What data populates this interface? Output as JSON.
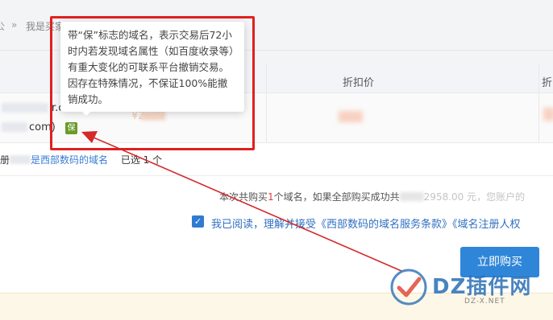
{
  "breadcrumb": {
    "home": "公",
    "separator": "»",
    "current": "我是买家"
  },
  "table": {
    "headers": {
      "discount_price": "折扣价",
      "more": "折"
    },
    "row": {
      "domain_1": "r.con",
      "domain_2": "com)",
      "protect_badge": "保",
      "price_symbol": "¥2530"
    }
  },
  "selection": {
    "prefix": "册",
    "link_text": "是西部数码的域名",
    "selected_count": "已选 1 个"
  },
  "summary": {
    "text_1": "本次共购买",
    "count": "1",
    "text_2": "个域名，如果全部购买成功共",
    "text_3": "2958.00 元，您账户的"
  },
  "agreement": {
    "checked_icon": "✓",
    "text": "我已阅读，理解并接受《西部数码的域名服务条款》《域名注册人权"
  },
  "actions": {
    "buy_now": "立即购买"
  },
  "tooltip": {
    "text": "带“保”标志的域名，表示交易后72小时内若发现域名属性（如百度收录等）有重大变化的可联系平台撤销交易。因存在特殊情况，不保证100%能撤销成功。"
  },
  "watermark": {
    "brand": "DZ插件网",
    "url": "DZ-X.NET"
  },
  "colors": {
    "accent_blue": "#2f86d8",
    "highlight_red": "#e02020",
    "protect_green": "#6a9b2c"
  }
}
